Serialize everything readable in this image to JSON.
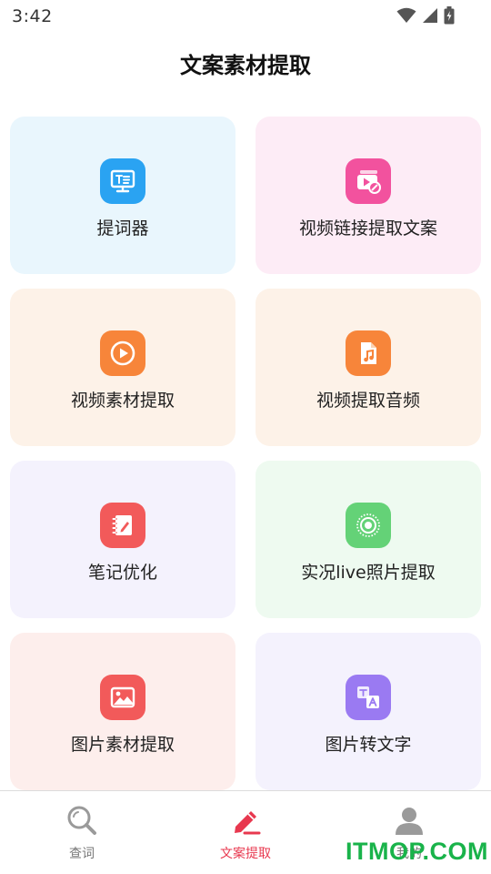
{
  "status_bar": {
    "time": "3:42"
  },
  "header": {
    "title": "文案素材提取"
  },
  "cards": [
    {
      "label": "提词器",
      "icon": "teleprompter-icon",
      "bg": "#e9f6fd",
      "icon_bg": "#2aa3f2"
    },
    {
      "label": "视频链接提取文案",
      "icon": "video-link-icon",
      "bg": "#fdecf6",
      "icon_bg": "#f2529e"
    },
    {
      "label": "视频素材提取",
      "icon": "play-icon",
      "bg": "#fdf2e8",
      "icon_bg": "#f7853a"
    },
    {
      "label": "视频提取音频",
      "icon": "music-file-icon",
      "bg": "#fdf2e8",
      "icon_bg": "#f7853a"
    },
    {
      "label": "笔记优化",
      "icon": "notebook-icon",
      "bg": "#f4f2fd",
      "icon_bg": "#f25a5a"
    },
    {
      "label": "实况live照片提取",
      "icon": "live-photo-icon",
      "bg": "#eefaf0",
      "icon_bg": "#64d277"
    },
    {
      "label": "图片素材提取",
      "icon": "image-icon",
      "bg": "#fdeeec",
      "icon_bg": "#f25a5a"
    },
    {
      "label": "图片转文字",
      "icon": "translate-icon",
      "bg": "#f4f2fd",
      "icon_bg": "#9a7af2"
    }
  ],
  "bottom_nav": [
    {
      "label": "查词",
      "icon": "search-icon",
      "active": false
    },
    {
      "label": "文案提取",
      "icon": "pen-icon",
      "active": true
    },
    {
      "label": "我的",
      "icon": "user-icon",
      "active": false
    }
  ],
  "watermark": {
    "text": "ITMOP.COM"
  },
  "colors": {
    "accent": "#e8384f",
    "inactive": "#9a9a9a"
  }
}
